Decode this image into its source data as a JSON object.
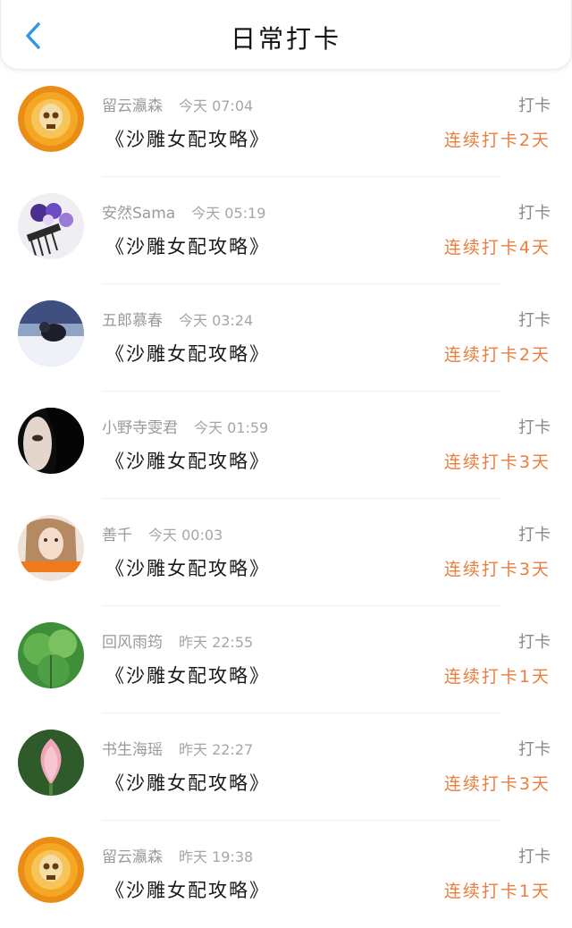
{
  "header": {
    "title": "日常打卡",
    "back_icon": "chevron-left-icon",
    "accent": "#2f98e8"
  },
  "colors": {
    "streak": "#ec7d3c",
    "meta": "#9a9a9a"
  },
  "items": [
    {
      "name": "留云瀛森",
      "time": "今天 07:04",
      "book": "《沙雕女配攻略》",
      "status": "打卡",
      "streak": "连续打卡2天",
      "avatar": "gold-skull-avatar"
    },
    {
      "name": "安然Sama",
      "time": "今天 05:19",
      "book": "《沙雕女配攻略》",
      "status": "打卡",
      "streak": "连续打卡4天",
      "avatar": "purple-flower-hairpin-avatar"
    },
    {
      "name": "五郎慕春",
      "time": "今天 03:24",
      "book": "《沙雕女配攻略》",
      "status": "打卡",
      "streak": "连续打卡2天",
      "avatar": "figure-in-snow-avatar"
    },
    {
      "name": "小野寺雯君",
      "time": "今天 01:59",
      "book": "《沙雕女配攻略》",
      "status": "打卡",
      "streak": "连续打卡3天",
      "avatar": "dark-hair-face-avatar"
    },
    {
      "name": "善千",
      "time": "今天 00:03",
      "book": "《沙雕女配攻略》",
      "status": "打卡",
      "streak": "连续打卡3天",
      "avatar": "girl-portrait-avatar"
    },
    {
      "name": "回风雨筠",
      "time": "昨天 22:55",
      "book": "《沙雕女配攻略》",
      "status": "打卡",
      "streak": "连续打卡1天",
      "avatar": "green-leaf-avatar"
    },
    {
      "name": "书生海瑶",
      "time": "昨天 22:27",
      "book": "《沙雕女配攻略》",
      "status": "打卡",
      "streak": "连续打卡3天",
      "avatar": "pink-lotus-avatar"
    },
    {
      "name": "留云瀛森",
      "time": "昨天 19:38",
      "book": "《沙雕女配攻略》",
      "status": "打卡",
      "streak": "连续打卡1天",
      "avatar": "gold-skull-avatar"
    }
  ]
}
